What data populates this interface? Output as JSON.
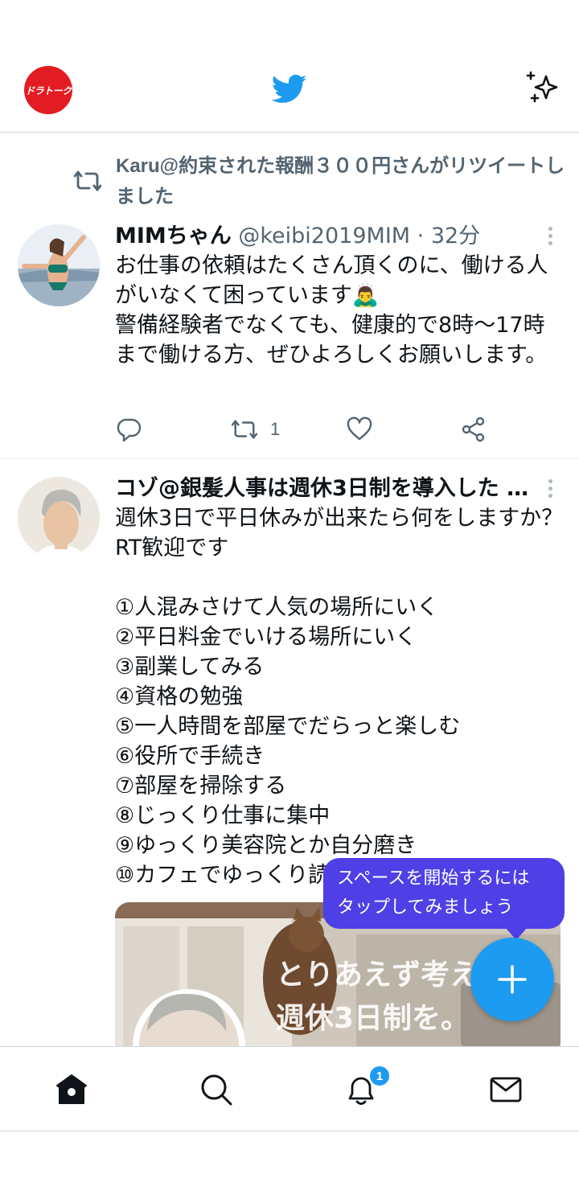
{
  "header": {
    "logo_text": "ドラトーク",
    "bird_icon": "twitter-bird-icon",
    "sparkle_icon": "sparkle-icon"
  },
  "tweets": [
    {
      "retweet_text": "Karu@約束された報酬３００円さんがリツイートしました",
      "name": "MIMちゃん",
      "handle": " @keibi2019MIM · 32分",
      "text": "お仕事の依頼はたくさん頂くのに、働ける人がいなくて困っています🙇‍♂️\n警備経験者でなくても、健康的で8時〜17時まで働ける方、ぜひよろしくお願いします。",
      "retweet_count": "1"
    },
    {
      "name": "コゾ@銀髪人事は週休3日制を導入した …",
      "text": "週休3日で平日休みが出来たら何をしますか？RT歓迎です\n\n①人混みさけて人気の場所にいく\n②平日料金でいける場所にいく\n③副業してみる\n④資格の勉強\n⑤一人時間を部屋でだらっと楽しむ\n⑥役所で手続き\n⑦部屋を掃除する\n⑧じっくり仕事に集中\n⑨ゆっくり美容院とか自分磨き\n⑩カフェでゆっくり読書",
      "media_text_line1": "とりあえず考え",
      "media_text_line2": "週休3日制を。"
    }
  ],
  "tooltip": {
    "line1": "スペースを開始するには",
    "line2": "タップしてみましょう"
  },
  "nav": {
    "notification_badge": "1"
  },
  "colors": {
    "twitter_blue": "#1d9bf0",
    "tooltip_purple": "#4e3fe6",
    "logo_red": "#e31b23"
  }
}
